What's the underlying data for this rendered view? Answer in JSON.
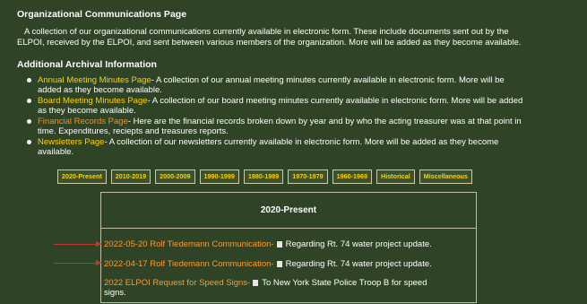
{
  "sections": {
    "org": {
      "title": "Organizational Communications Page",
      "line1": "A collection of our organizational communications currently available in electronic form. These include documents sent out by the",
      "line2": "ELPOI, received by the ELPOI, and sent between various members of the organization. More will be added as they become available."
    },
    "archival": {
      "title": "Additional Archival Information",
      "items": [
        {
          "link": "Annual Meeting Minutes Page",
          "text": "- A collection of our annual meeting minutes currently available in electronic form. More will be",
          "text2": "added as they become available."
        },
        {
          "link": "Board Meeting Minutes Page",
          "text": "- A collection of our board meeting minutes currently available in electronic form. More will be added",
          "text2": "as they become available."
        },
        {
          "link": "Financial Records Page",
          "text": "- Here are the financial records broken down by year and by who the acting treasurer was at that point in",
          "text2": "time. Expenditures, reciepts and treasures reports."
        },
        {
          "link": "Newsletters Page",
          "text": "- A collection of our newsletters currently available in electronic form. More will be added as they become",
          "text2": "available."
        }
      ]
    }
  },
  "tabs": [
    "2020-Present",
    "2010-2019",
    "2000-2009",
    "1990-1999",
    "1980-1989",
    "1970-1979",
    "1960-1969",
    "Historical",
    "Miscellaneous"
  ],
  "panel": {
    "title": "2020-Present",
    "entries": [
      {
        "title": "2022-05-20 Rolf Tiedemann Communication-",
        "desc": "Regarding Rt. 74 water project update."
      },
      {
        "title": "2022-04-17 Rolf Tiedemann Communication-",
        "desc": "Regarding Rt. 74 water project update."
      },
      {
        "title": "2022 ELPOI Request for Speed Signs-",
        "desc": "To New York State Police Troop B for speed",
        "desc2": "signs."
      }
    ]
  },
  "colors": {
    "background": "#2f4326",
    "link": "#ffd200",
    "accent_link": "#ff8c1a",
    "arrow": "#c0392b"
  }
}
